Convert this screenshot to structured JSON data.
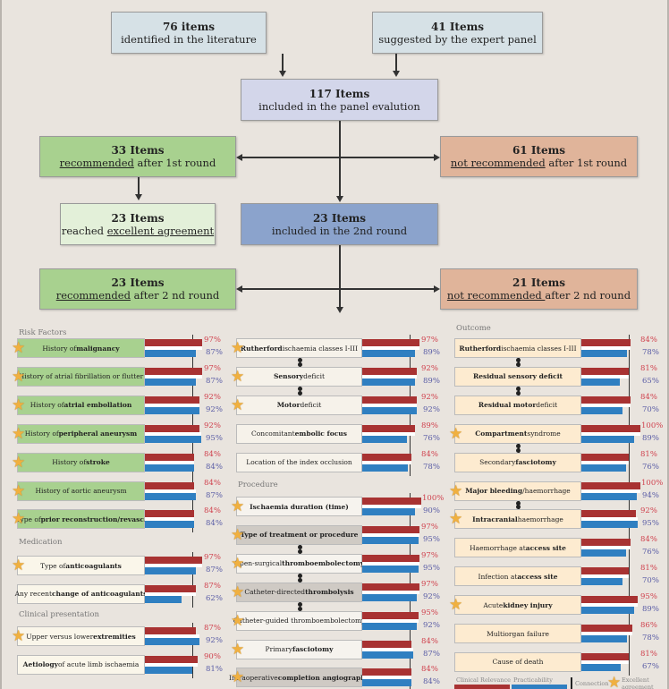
{
  "flow": {
    "lit": {
      "count": "76 items",
      "text": "identified in the literature"
    },
    "expert": {
      "count": "41 Items",
      "text": "suggested by the expert panel"
    },
    "panel": {
      "count": "117 Items",
      "text": "included in the panel evalution"
    },
    "rec1": {
      "count": "33 Items",
      "u": "recommended",
      "text": " after 1st round"
    },
    "notrec1": {
      "count": "61 Items",
      "u": "not recommended",
      "text": " after  1st round"
    },
    "excellent": {
      "count": "23 Items",
      "pre": "reached ",
      "u": "excellent agreement"
    },
    "round2": {
      "count": "23 Items",
      "text": "included in the 2nd round"
    },
    "rec2": {
      "count": "23 Items",
      "u": "recommended",
      "text": " after 2 nd round"
    },
    "notrec2": {
      "count": "21 Items",
      "u": "not recommended ",
      "text": "after  2 nd round"
    }
  },
  "colors": {
    "clinical_relevance": "#a83232",
    "practicability": "#2f7fc1",
    "recommended": "#a8d18f",
    "not_recommended": "#e0b49a"
  },
  "threshold_percent": 80,
  "sections": [
    {
      "title": "Risk Factors",
      "col": 0,
      "fill": "#a8d18f",
      "items": [
        {
          "pre": "History of ",
          "bold": "malignancy",
          "post": "",
          "cr": 97,
          "pr": 87,
          "star": true
        },
        {
          "pre": "History of atrial fibrillation or flutter",
          "bold": "",
          "post": "",
          "cr": 97,
          "pr": 87,
          "star": true
        },
        {
          "pre": "History of ",
          "bold": "atrial embollation",
          "post": "",
          "cr": 92,
          "pr": 92,
          "star": true
        },
        {
          "pre": "History of ",
          "bold": "peripheral aneurysm",
          "post": "",
          "cr": 92,
          "pr": 95,
          "star": true
        },
        {
          "pre": "History of ",
          "bold": "stroke",
          "post": "",
          "cr": 84,
          "pr": 84,
          "star": true
        },
        {
          "pre": "History of aortic aneurysm",
          "bold": "",
          "post": "",
          "cr": 84,
          "pr": 87,
          "star": true
        },
        {
          "pre": "Type of ",
          "bold": "prior reconstruction/revasc.",
          "post": "",
          "cr": 84,
          "pr": 84,
          "star": true
        }
      ]
    },
    {
      "title": "Medication",
      "col": 0,
      "fill": "#faf6ea",
      "items": [
        {
          "pre": "Type of ",
          "bold": "anticoagulants",
          "post": "",
          "cr": 97,
          "pr": 87,
          "star": true
        },
        {
          "pre": "Any recent ",
          "bold": "change of anticoagulants",
          "post": "",
          "cr": 87,
          "pr": 62,
          "star": false
        }
      ]
    },
    {
      "title": "Clinical presentation",
      "col": 0,
      "fill": "#faf6ea",
      "items": [
        {
          "pre": "Upper versus lower ",
          "bold": "extremities",
          "post": "",
          "cr": 87,
          "pr": 92,
          "star": true
        },
        {
          "pre": "",
          "bold": "Aetiology",
          "post": " of acute limb ischaemia",
          "cr": 90,
          "pr": 81,
          "star": false
        }
      ]
    },
    {
      "title": "",
      "col": 1,
      "fill": "#f6f2ea",
      "items": [
        {
          "pre": "",
          "bold": "Rutherford",
          "post": " ischaemia classes I-III",
          "cr": 97,
          "pr": 89,
          "star": true,
          "link": true
        },
        {
          "pre": "",
          "bold": "Sensory",
          "post": " deficit",
          "cr": 92,
          "pr": 89,
          "star": true,
          "link": true
        },
        {
          "pre": "",
          "bold": "Motor",
          "post": " deficit",
          "cr": 92,
          "pr": 92,
          "star": true
        },
        {
          "pre": "Concomitant ",
          "bold": "embolic focus",
          "post": "",
          "cr": 89,
          "pr": 76,
          "star": false
        },
        {
          "pre": "Location of the index occlusion",
          "bold": "",
          "post": "",
          "cr": 84,
          "pr": 78,
          "star": false
        }
      ]
    },
    {
      "title": "Procedure",
      "col": 1,
      "fill": "#f6f3ee",
      "items": [
        {
          "pre": "",
          "bold": "Ischaemia duration (time)",
          "post": "",
          "cr": 100,
          "pr": 90,
          "star": true
        },
        {
          "pre": "",
          "bold": "Type of treatment or procedure",
          "post": "",
          "cr": 97,
          "pr": 95,
          "star": true,
          "link": true,
          "gray": true
        },
        {
          "pre": "Open-surgical ",
          "bold": "thromboembolectomy",
          "post": "",
          "cr": 97,
          "pr": 95,
          "star": true,
          "link": true
        },
        {
          "pre": "Catheter-directed ",
          "bold": "thrombolysis",
          "post": "",
          "cr": 97,
          "pr": 92,
          "star": true,
          "link": true,
          "gray": true
        },
        {
          "pre": "Catheter-guided thromboembolectomy",
          "bold": "",
          "post": "",
          "cr": 95,
          "pr": 92,
          "star": true
        },
        {
          "pre": "Primary ",
          "bold": "fasciotomy",
          "post": "",
          "cr": 84,
          "pr": 87,
          "star": true
        },
        {
          "pre": "Intraoperative ",
          "bold": "completion angiography",
          "post": "",
          "cr": 84,
          "pr": 84,
          "star": true,
          "gray": true
        }
      ]
    },
    {
      "title": "Outcome",
      "col": 2,
      "fill": "#fdebd0",
      "items": [
        {
          "pre": "",
          "bold": "Rutherford",
          "post": " ischaemia classes I-III",
          "cr": 84,
          "pr": 78,
          "star": false,
          "link": true
        },
        {
          "pre": "",
          "bold": "Residual sensory deficit",
          "post": "",
          "cr": 81,
          "pr": 65,
          "star": false,
          "link": true
        },
        {
          "pre": "",
          "bold": "Residual motor",
          "post": " deficit",
          "cr": 84,
          "pr": 70,
          "star": false
        },
        {
          "pre": "",
          "bold": "Compartment",
          "post": " syndrome",
          "cr": 100,
          "pr": 89,
          "star": true,
          "link": true
        },
        {
          "pre": "Secondary ",
          "bold": "fasciotomy",
          "post": "",
          "cr": 81,
          "pr": 76,
          "star": false
        },
        {
          "pre": "",
          "bold": "Major bleeding",
          "post": "/haemorrhage",
          "cr": 100,
          "pr": 94,
          "star": true,
          "link": true
        },
        {
          "pre": "",
          "bold": "Intracranial",
          "post": " haemorrhage",
          "cr": 92,
          "pr": 95,
          "star": true
        },
        {
          "pre": "Haemorrhage at ",
          "bold": "access site",
          "post": "",
          "cr": 84,
          "pr": 76,
          "star": false
        },
        {
          "pre": "Infection at ",
          "bold": "access site",
          "post": "",
          "cr": 81,
          "pr": 70,
          "star": false
        },
        {
          "pre": "Acute ",
          "bold": "kidney injury",
          "post": "",
          "cr": 95,
          "pr": 89,
          "star": true
        },
        {
          "pre": "Multiorgan failure",
          "bold": "",
          "post": "",
          "cr": 86,
          "pr": 78,
          "star": false
        },
        {
          "pre": "Cause of death",
          "bold": "",
          "post": "",
          "cr": 81,
          "pr": 67,
          "star": false
        }
      ]
    }
  ],
  "legend": {
    "clinical": "Clinical Relevance",
    "practicability": "Practicability",
    "connection": "Connection",
    "excellent": "Excellent agreement"
  }
}
